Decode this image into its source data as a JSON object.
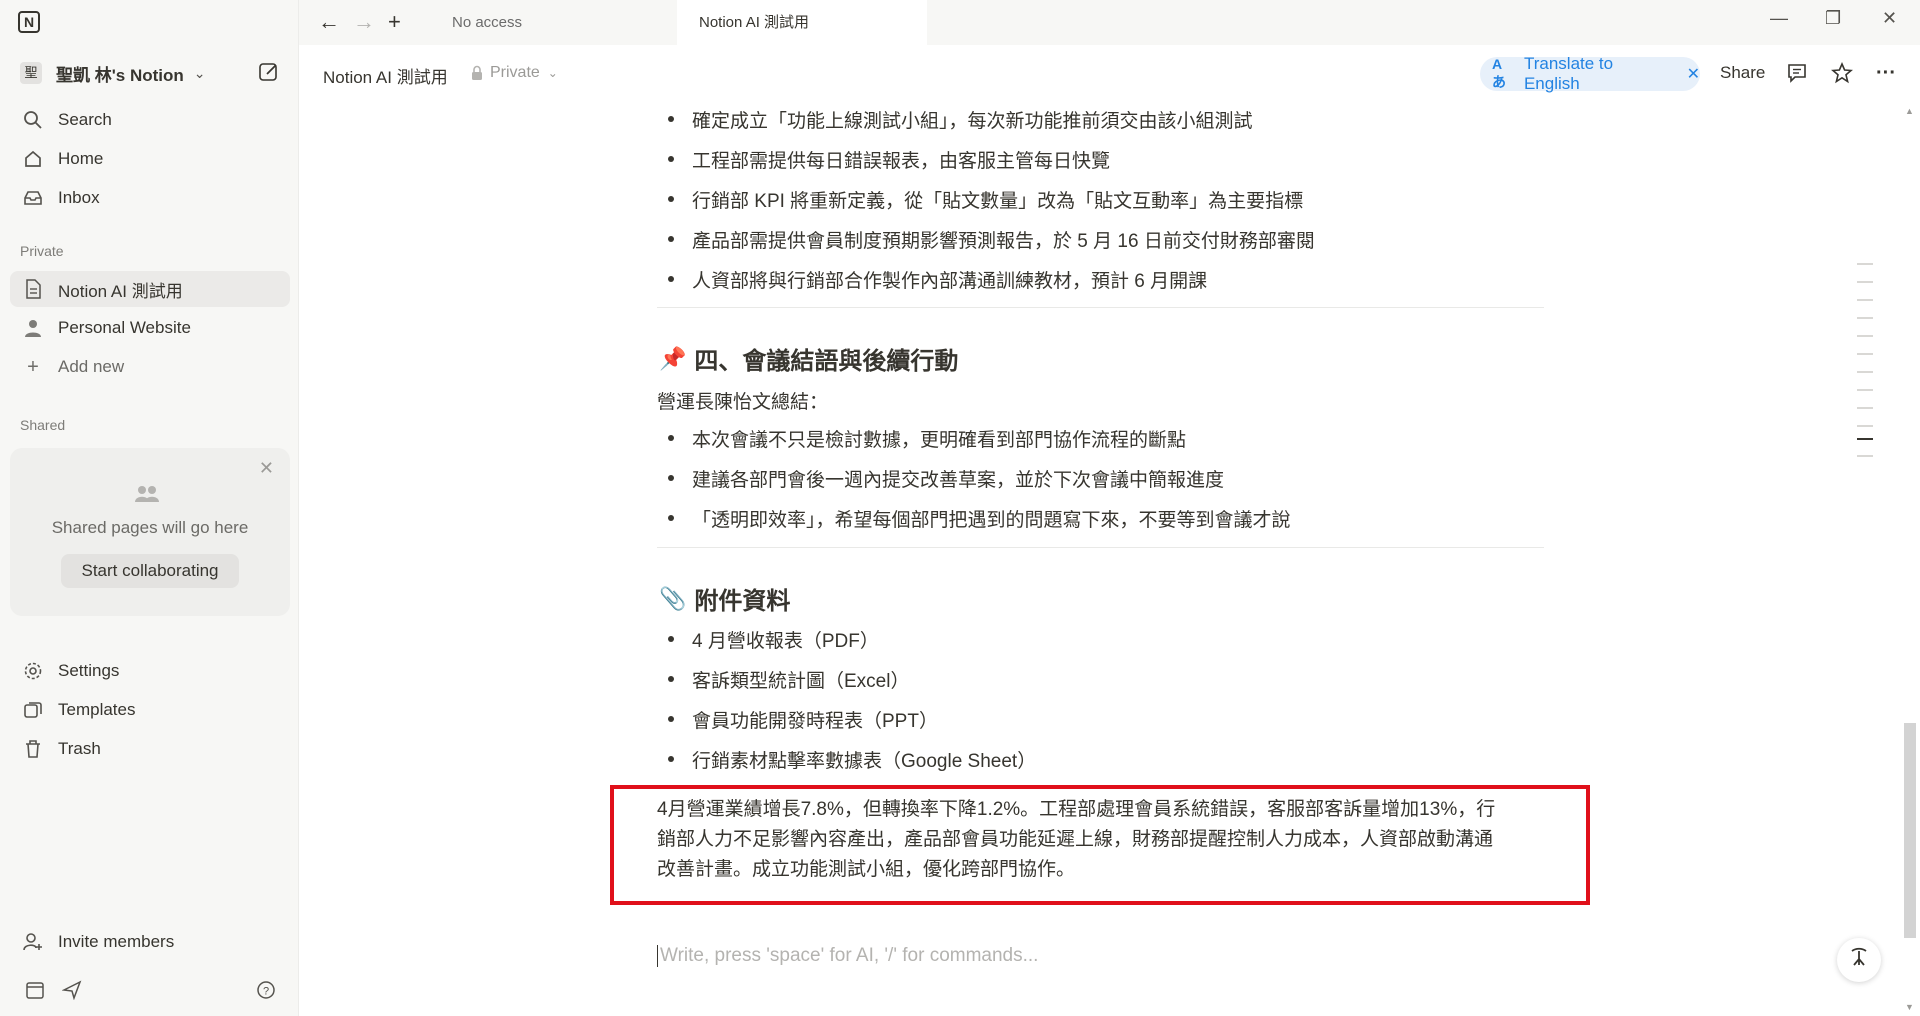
{
  "titlebar": {
    "tabs": [
      {
        "label": "No access"
      },
      {
        "label": "Notion AI 測試用"
      }
    ]
  },
  "sidebar": {
    "workspace_avatar": "聖",
    "workspace_name": "聖凱 林's Notion",
    "nav": [
      {
        "label": "Search",
        "icon": "search-icon"
      },
      {
        "label": "Home",
        "icon": "home-icon"
      },
      {
        "label": "Inbox",
        "icon": "inbox-icon"
      }
    ],
    "private_heading": "Private",
    "private_pages": [
      {
        "label": "Notion AI 測試用",
        "icon": "page-icon"
      },
      {
        "label": "Personal Website",
        "icon": "person-icon"
      }
    ],
    "add_new": "Add new",
    "shared_heading": "Shared",
    "shared_card": {
      "message": "Shared pages will go here",
      "button": "Start collaborating"
    },
    "footer_nav": [
      {
        "label": "Settings",
        "icon": "gear-icon"
      },
      {
        "label": "Templates",
        "icon": "templates-icon"
      },
      {
        "label": "Trash",
        "icon": "trash-icon"
      }
    ],
    "invite": "Invite members"
  },
  "header": {
    "breadcrumb": "Notion AI 測試用",
    "privacy": "Private",
    "translate": "Translate to English",
    "share": "Share"
  },
  "content": {
    "action_items": [
      "確定成立「功能上線測試小組」，每次新功能推前須交由該小組測試",
      "工程部需提供每日錯誤報表，由客服主管每日快覽",
      "行銷部 KPI 將重新定義，從「貼文數量」改為「貼文互動率」為主要指標",
      "產品部需提供會員制度預期影響預測報告，於 5 月 16 日前交付財務部審閱",
      "人資部將與行銷部合作製作內部溝通訓練教材，預計 6 月開課"
    ],
    "section4": {
      "emoji": "📌",
      "title": "四、會議結語與後續行動",
      "intro": "營運長陳怡文總結：",
      "items": [
        "本次會議不只是檢討數據，更明確看到部門協作流程的斷點",
        "建議各部門會後一週內提交改善草案，並於下次會議中簡報進度",
        "「透明即效率」，希望每個部門把遇到的問題寫下來，不要等到會議才說"
      ]
    },
    "attachments": {
      "emoji": "📎",
      "title": "附件資料",
      "items": [
        "4 月營收報表（PDF）",
        "客訴類型統計圖（Excel）",
        "會員功能開發時程表（PPT）",
        "行銷素材點擊率數據表（Google Sheet）"
      ]
    },
    "summary_lines": [
      "4月營運業績增長7.8%，但轉換率下降1.2%。工程部處理會員系統錯誤，客服部客訴量增加13%，行",
      "銷部人力不足影響內容產出，產品部會員功能延遲上線，財務部提醒控制人力成本，人資部啟動溝通",
      "改善計畫。成立功能測試小組，優化跨部門協作。"
    ],
    "placeholder": "Write, press 'space' for AI, '/' for commands..."
  },
  "colors": {
    "highlight_border": "#e0101a",
    "accent": "#2383e2"
  }
}
